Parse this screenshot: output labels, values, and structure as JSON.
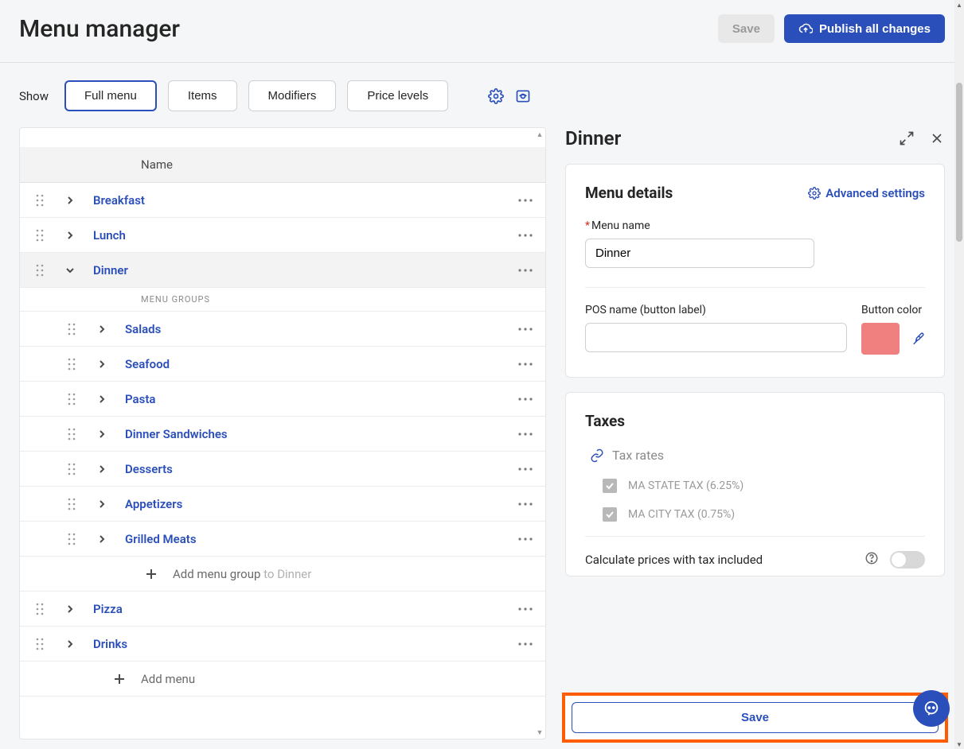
{
  "header": {
    "title": "Menu manager",
    "save_label": "Save",
    "publish_label": "Publish all changes"
  },
  "filters": {
    "show_label": "Show",
    "tabs": [
      "Full menu",
      "Items",
      "Modifiers",
      "Price levels"
    ],
    "active_index": 0
  },
  "tree": {
    "name_header": "Name",
    "menus": [
      {
        "label": "Breakfast",
        "expanded": false
      },
      {
        "label": "Lunch",
        "expanded": false
      },
      {
        "label": "Dinner",
        "expanded": true,
        "selected": true,
        "groups_header": "MENU GROUPS",
        "groups": [
          {
            "label": "Salads"
          },
          {
            "label": "Seafood"
          },
          {
            "label": "Pasta"
          },
          {
            "label": "Dinner Sandwiches"
          },
          {
            "label": "Desserts"
          },
          {
            "label": "Appetizers"
          },
          {
            "label": "Grilled Meats"
          }
        ],
        "add_group_prefix": "Add menu group",
        "add_group_suffix": "to Dinner"
      },
      {
        "label": "Pizza",
        "expanded": false
      },
      {
        "label": "Drinks",
        "expanded": false
      }
    ],
    "add_menu_label": "Add menu"
  },
  "details": {
    "panel_title": "Dinner",
    "section_title": "Menu details",
    "advanced_label": "Advanced settings",
    "menu_name_label": "Menu name",
    "menu_name_value": "Dinner",
    "pos_name_label": "POS name (button label)",
    "pos_name_value": "",
    "button_color_label": "Button color",
    "button_color": "#f08080"
  },
  "taxes": {
    "section_title": "Taxes",
    "tax_rates_label": "Tax rates",
    "items": [
      {
        "label": "MA STATE TAX (6.25%)",
        "checked": true
      },
      {
        "label": "MA CITY TAX (0.75%)",
        "checked": true
      }
    ],
    "calc_label": "Calculate prices with tax included",
    "calc_enabled": false
  },
  "footer": {
    "save_label": "Save"
  }
}
